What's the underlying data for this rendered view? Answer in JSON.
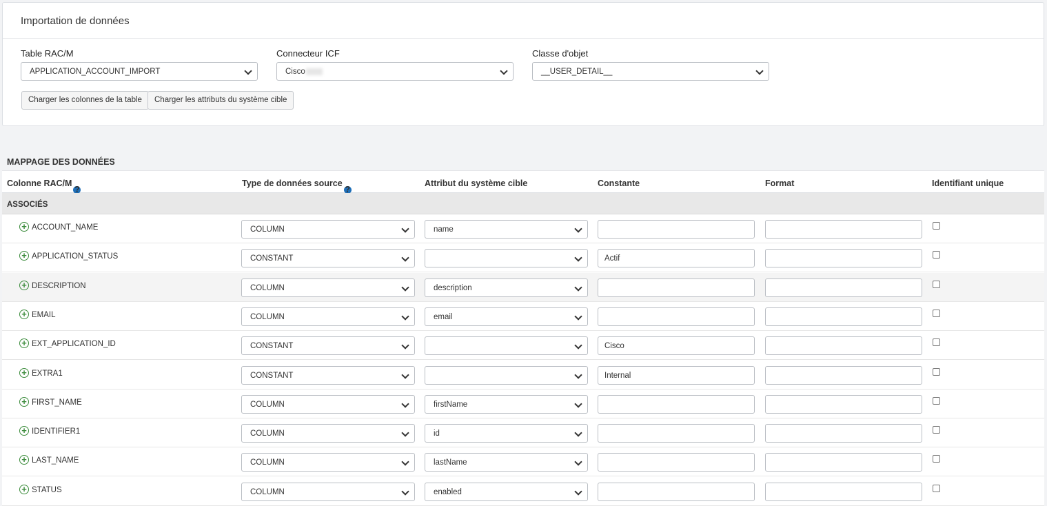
{
  "panel": {
    "title": "Importation de données",
    "fields": [
      {
        "label": "Table RAC/M",
        "value": "APPLICATION_ACCOUNT_IMPORT"
      },
      {
        "label": "Connecteur ICF",
        "value": "Cisco"
      },
      {
        "label": "Classe d'objet",
        "value": "__USER_DETAIL__"
      }
    ],
    "buttons": [
      "Charger les colonnes de la table",
      "Charger les attributs du système cible"
    ]
  },
  "mapping": {
    "title": "MAPPAGE DES DONNÉES",
    "headers": [
      "Colonne RAC/M",
      "Type de données source",
      "Attribut du système cible",
      "Constante",
      "Format",
      "Identifiant unique"
    ],
    "group_label": "ASSOCIÉS",
    "rows": [
      {
        "column": "ACCOUNT_NAME",
        "type": "COLUMN",
        "attribute": "name",
        "constant": "",
        "format": ""
      },
      {
        "column": "APPLICATION_STATUS",
        "type": "CONSTANT",
        "attribute": "",
        "constant": "Actif",
        "format": ""
      },
      {
        "column": "DESCRIPTION",
        "type": "COLUMN",
        "attribute": "description",
        "constant": "",
        "format": ""
      },
      {
        "column": "EMAIL",
        "type": "COLUMN",
        "attribute": "email",
        "constant": "",
        "format": ""
      },
      {
        "column": "EXT_APPLICATION_ID",
        "type": "CONSTANT",
        "attribute": "",
        "constant": "Cisco",
        "format": ""
      },
      {
        "column": "EXTRA1",
        "type": "CONSTANT",
        "attribute": "",
        "constant": "Internal",
        "format": ""
      },
      {
        "column": "FIRST_NAME",
        "type": "COLUMN",
        "attribute": "firstName",
        "constant": "",
        "format": ""
      },
      {
        "column": "IDENTIFIER1",
        "type": "COLUMN",
        "attribute": "id",
        "constant": "",
        "format": ""
      },
      {
        "column": "LAST_NAME",
        "type": "COLUMN",
        "attribute": "lastName",
        "constant": "",
        "format": ""
      },
      {
        "column": "STATUS",
        "type": "COLUMN",
        "attribute": "enabled",
        "constant": "",
        "format": ""
      }
    ]
  },
  "icons": {
    "add": "plus-circle-icon",
    "help": "question-circle-icon",
    "dropdown": "chevron-down-icon"
  },
  "colors": {
    "add_icon": "#3c8c3c",
    "help_icon": "#1f6fb8",
    "group_band": "#e8e8e8"
  }
}
